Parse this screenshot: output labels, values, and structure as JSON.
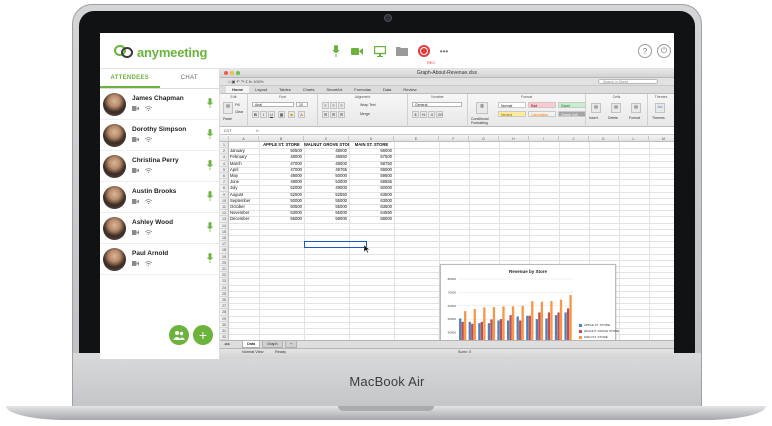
{
  "app": {
    "logo_prefix": "any",
    "logo_suffix": "meeting",
    "rec_label": "REC",
    "more_label": "•••",
    "help_label": "?",
    "power_label": "⏻"
  },
  "sidebar": {
    "tabs": [
      {
        "label": "ATTENDEES",
        "active": true
      },
      {
        "label": "CHAT",
        "active": false
      }
    ],
    "attendees": [
      {
        "name": "James Chapman"
      },
      {
        "name": "Dorothy Simpson"
      },
      {
        "name": "Christina Perry"
      },
      {
        "name": "Austin Brooks"
      },
      {
        "name": "Ashley Wood"
      },
      {
        "name": "Paul Arnold"
      }
    ],
    "add_label": "+"
  },
  "excel": {
    "document_title": "Graph-About-Revenue.xlsx",
    "quick_access": "⌂  ▣  ↶  ↷  Σ  fx  100%",
    "search_placeholder": "Search in Sheet",
    "ribbon_tabs": [
      "Home",
      "Layout",
      "Tables",
      "Charts",
      "SmartArt",
      "Formulas",
      "Data",
      "Review"
    ],
    "active_ribbon_tab": "Home",
    "group_labels": {
      "edit": "Edit",
      "font": "Font",
      "alignment": "Alignment",
      "number": "Number",
      "format": "Format",
      "cells": "Cells",
      "themes": "Themes"
    },
    "font_name": "Arial",
    "font_size": "10",
    "fill_label": "Fill",
    "clear_label": "Clear",
    "paste_label": "Paste",
    "wrap_text_label": "Wrap Text",
    "merge_label": "Merge",
    "number_format": "General",
    "conditional_formatting": "Conditional Formatting",
    "styles": [
      {
        "label": "Normal",
        "bg": "#ffffff",
        "color": "#222222"
      },
      {
        "label": "Bad",
        "bg": "#ffc7ce",
        "color": "#9c0006"
      },
      {
        "label": "Good",
        "bg": "#c6efce",
        "color": "#006100"
      },
      {
        "label": "Neutral",
        "bg": "#ffeb9c",
        "color": "#9c6500"
      },
      {
        "label": "Calculation",
        "bg": "#f2f2f2",
        "color": "#fa7d00"
      },
      {
        "label": "Check Cell",
        "bg": "#a5a5a5",
        "color": "#ffffff"
      }
    ],
    "cell_buttons": [
      "Insert",
      "Delete",
      "Format"
    ],
    "themes_button": "Themes",
    "cell_ref": "C17",
    "formula_icon": "fx",
    "columns": [
      "A",
      "B",
      "C",
      "D",
      "E",
      "F",
      "G",
      "H",
      "I",
      "J",
      "K",
      "L",
      "M"
    ],
    "headers": [
      "APPLE ST. STORE",
      "WALNUT GROVE STORE",
      "MAIN ST. STORE"
    ],
    "rows": [
      {
        "month": "January",
        "apple": "50500",
        "walnut": "48000",
        "main": "56000"
      },
      {
        "month": "February",
        "apple": "48000",
        "walnut": "46550",
        "main": "57500"
      },
      {
        "month": "March",
        "apple": "47000",
        "walnut": "48000",
        "main": "58750"
      },
      {
        "month": "April",
        "apple": "47000",
        "walnut": "49765",
        "main": "59000"
      },
      {
        "month": "May",
        "apple": "49000",
        "walnut": "50000",
        "main": "59500"
      },
      {
        "month": "June",
        "apple": "49000",
        "walnut": "53000",
        "main": "59555"
      },
      {
        "month": "July",
        "apple": "52000",
        "walnut": "49000",
        "main": "60000"
      },
      {
        "month": "August",
        "apple": "52500",
        "walnut": "52550",
        "main": "63500"
      },
      {
        "month": "September",
        "apple": "50000",
        "walnut": "55000",
        "main": "63000"
      },
      {
        "month": "October",
        "apple": "50500",
        "walnut": "55000",
        "main": "63500"
      },
      {
        "month": "November",
        "apple": "53000",
        "walnut": "55000",
        "main": "64590"
      },
      {
        "month": "December",
        "apple": "55000",
        "walnut": "58000",
        "main": "68000"
      }
    ],
    "sheet_tabs": [
      {
        "label": "Data",
        "active": true
      },
      {
        "label": "Graph",
        "active": false
      }
    ],
    "add_sheet_label": "+",
    "status": {
      "view": "Normal View",
      "state": "Ready",
      "sum": "Sum= 0"
    }
  },
  "chart_data": {
    "type": "bar",
    "title": "Revenue by Store",
    "categories": [
      "January",
      "February",
      "March",
      "April",
      "May",
      "June",
      "July",
      "August",
      "September",
      "October",
      "November",
      "December"
    ],
    "series": [
      {
        "name": "APPLE ST. STORE",
        "values": [
          50500,
          48000,
          47000,
          47000,
          49000,
          49000,
          52000,
          52500,
          50000,
          50500,
          53000,
          55000
        ]
      },
      {
        "name": "WALNUT GROVE STORE",
        "values": [
          48000,
          46550,
          48000,
          49765,
          50000,
          53000,
          49000,
          52550,
          55000,
          55000,
          55000,
          58000
        ]
      },
      {
        "name": "MAIN ST. STORE",
        "values": [
          56000,
          57500,
          58750,
          59000,
          59500,
          59555,
          60000,
          63500,
          63000,
          63500,
          64590,
          68000
        ]
      }
    ],
    "ylim": [
      0,
      80000
    ],
    "yticks": [
      0,
      10000,
      20000,
      30000,
      40000,
      50000,
      60000,
      70000,
      80000
    ],
    "grid": true,
    "legend": "right",
    "colors": [
      "#4f81bd",
      "#c0504d",
      "#f79646"
    ]
  },
  "device": {
    "brand": "MacBook Air"
  },
  "colors": {
    "accent": "#6bb33c",
    "record": "#e03a3a",
    "selection": "#1b57c9"
  }
}
